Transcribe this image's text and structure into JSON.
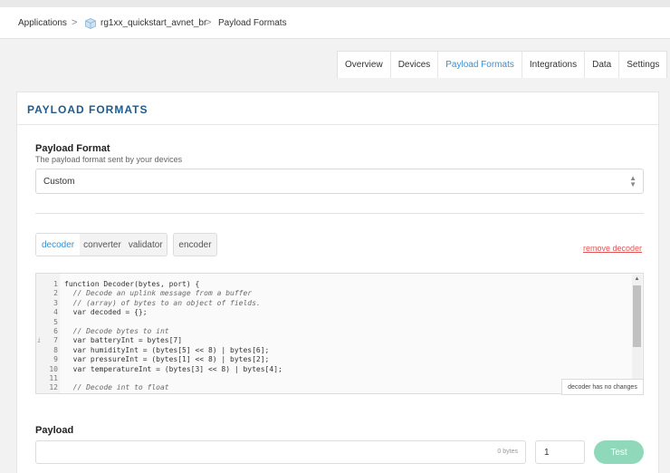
{
  "breadcrumb": {
    "applications": "Applications",
    "app_name": "rg1xx_quickstart_avnet_br",
    "current": "Payload Formats",
    "separator": ">"
  },
  "tabs": [
    {
      "label": "Overview",
      "active": false
    },
    {
      "label": "Devices",
      "active": false
    },
    {
      "label": "Payload Formats",
      "active": true
    },
    {
      "label": "Integrations",
      "active": false
    },
    {
      "label": "Data",
      "active": false
    },
    {
      "label": "Settings",
      "active": false
    }
  ],
  "card": {
    "title": "PAYLOAD FORMATS",
    "payload_format": {
      "label": "Payload Format",
      "description": "The payload format sent by your devices",
      "selected": "Custom"
    },
    "function_tabs": {
      "decoder": "decoder",
      "converter": "converter",
      "validator": "validator",
      "encoder": "encoder",
      "active": "decoder"
    },
    "remove_link": "remove decoder",
    "code_status": "decoder has no changes",
    "code_lines": [
      "function Decoder(bytes, port) {",
      "  // Decode an uplink message from a buffer",
      "  // (array) of bytes to an object of fields.",
      "  var decoded = {};",
      "",
      "  // Decode bytes to int",
      "  var batteryInt = bytes[7]",
      "  var humidityInt = (bytes[5] << 8) | bytes[6];",
      "  var pressureInt = (bytes[1] << 8) | bytes[2];",
      "  var temperatureInt = (bytes[3] << 8) | bytes[4];",
      "",
      "  // Decode int to float"
    ],
    "line_numbers": [
      "1",
      "2",
      "3",
      "4",
      "5",
      "6",
      "7",
      "8",
      "9",
      "10",
      "11",
      "12"
    ],
    "payload": {
      "label": "Payload",
      "value": "",
      "bytes": "0 bytes",
      "port": "1",
      "test_label": "Test"
    }
  },
  "colors": {
    "accent": "#3a8fd0",
    "title": "#1f5b8f",
    "danger": "#e05555",
    "test_button": "#8fd8b9"
  }
}
